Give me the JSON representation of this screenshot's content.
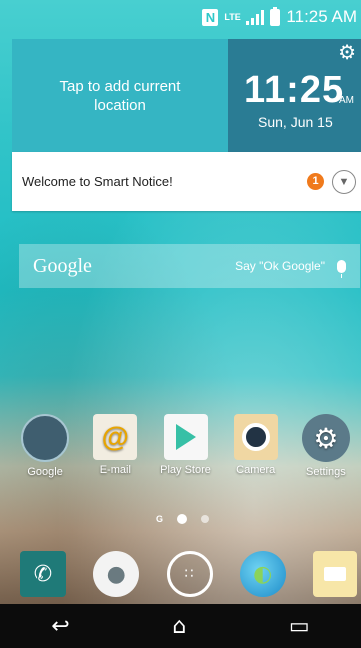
{
  "status_bar": {
    "time": "11:25 AM",
    "icons": [
      "nfc-icon",
      "lte-icon",
      "signal-icon",
      "battery-icon"
    ],
    "nfc_label": "N",
    "lte_label": "LTE"
  },
  "weather_widget": {
    "location_prompt": "Tap to add current location",
    "time": "11:25",
    "ampm": "AM",
    "date": "Sun, Jun 15"
  },
  "smart_notice": {
    "message": "Welcome to Smart Notice!",
    "badge_count": "1"
  },
  "search_bar": {
    "logo": "Google",
    "hint": "Say \"Ok Google\""
  },
  "apps": [
    {
      "label": "Google",
      "icon": "google-folder-icon"
    },
    {
      "label": "E-mail",
      "icon": "email-icon"
    },
    {
      "label": "Play Store",
      "icon": "play-store-icon"
    },
    {
      "label": "Camera",
      "icon": "camera-icon"
    },
    {
      "label": "Settings",
      "icon": "settings-icon"
    }
  ],
  "page_indicator": {
    "g_label": "G",
    "current_page": 1,
    "total_pages": 2
  },
  "dock": [
    "phone-icon",
    "contacts-icon",
    "apps-icon",
    "browser-icon",
    "messages-icon"
  ],
  "nav_bar": [
    "back-icon",
    "home-icon",
    "recent-apps-icon"
  ],
  "colors": {
    "notice_badge": "#f07a1c",
    "clock_pane": "#2a7c94",
    "location_pane": "#35b5c3"
  }
}
